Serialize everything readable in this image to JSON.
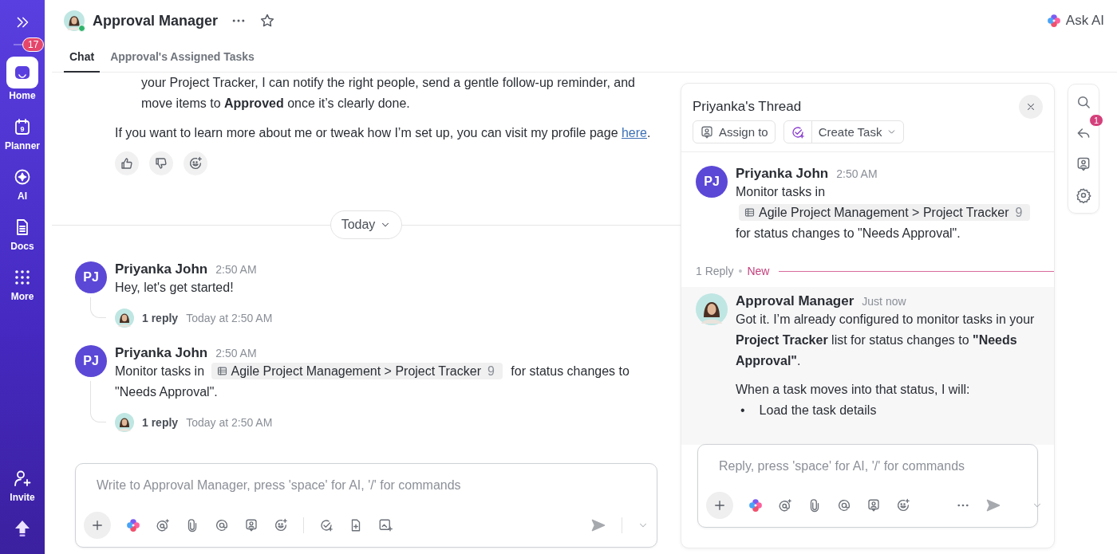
{
  "sidebar": {
    "items": [
      {
        "kind": "home",
        "label": "Home",
        "badge": "17",
        "selected": true
      },
      {
        "kind": "planner",
        "label": "Planner",
        "day": "9",
        "selected": false
      },
      {
        "kind": "ai",
        "label": "AI",
        "selected": false
      },
      {
        "kind": "docs",
        "label": "Docs",
        "selected": false
      },
      {
        "kind": "more",
        "label": "More",
        "selected": false
      }
    ],
    "bottom_items": [
      {
        "kind": "invite",
        "label": "Invite"
      },
      {
        "kind": "upgrade"
      }
    ]
  },
  "header": {
    "title": "Approval Manager",
    "online": true,
    "ask_ai": "Ask AI",
    "tabs": [
      {
        "label": "Chat",
        "selected": true
      },
      {
        "label": "Approval's Assigned Tasks",
        "selected": false
      }
    ]
  },
  "chat": {
    "earlier": {
      "list_item": "your Project Tracker, I can notify the right people, send a gentle follow-up reminder, and move items to **Approved** once it’s clearly done.",
      "paragraph": "If you want to learn more about me or tweak how I’m set up, you can visit my profile page ",
      "link": "here",
      "paragraph_end": "."
    },
    "day_divider": "Today",
    "messages": [
      {
        "initials": "PJ",
        "author": "Priyanka John",
        "time": "2:50 AM",
        "text": "Hey, let's get started!",
        "replies": "1 reply",
        "last_reply": "Today at 2:50 AM"
      },
      {
        "initials": "PJ",
        "author": "Priyanka John",
        "time": "2:50 AM",
        "text": "Monitor tasks in",
        "chip": {
          "label": "Agile Project Management > Project Tracker",
          "count": "9"
        },
        "text_after": "for status changes to \"Needs Approval\".",
        "replies": "1 reply",
        "last_reply": "Today at 2:50 AM"
      }
    ],
    "composer": {
      "placeholder": "Write to Approval Manager, press 'space' for AI, '/' for commands"
    }
  },
  "thread": {
    "title": "Priyanka's Thread",
    "actions": [
      {
        "kind": "assign",
        "label": "Assign to"
      },
      {
        "kind": "create_task",
        "label": "Create Task"
      }
    ],
    "root": {
      "initials": "PJ",
      "author": "Priyanka John",
      "time": "2:50 AM",
      "text": "Monitor tasks in",
      "chip": {
        "label": "Agile Project Management > Project Tracker",
        "count": "9"
      },
      "text_after": "for status changes to \"Needs Approval\"."
    },
    "reply_count": "1 Reply",
    "reply_separator": "•",
    "new_label": "New",
    "replies": [
      {
        "author": "Approval Manager",
        "time": "Just now",
        "paragraphs": [
          "Got it. I’m already configured to monitor tasks in your **Project Tracker** list for status changes to **\"Needs Approval\"**.",
          "When a task moves into that status, I will:"
        ],
        "bullets": [
          {
            "marker": "•",
            "text": "Load the task details"
          }
        ]
      }
    ],
    "composer": {
      "placeholder": "Reply, press 'space' for AI, '/' for commands"
    }
  },
  "side_toolbar": {
    "badge": "1"
  }
}
